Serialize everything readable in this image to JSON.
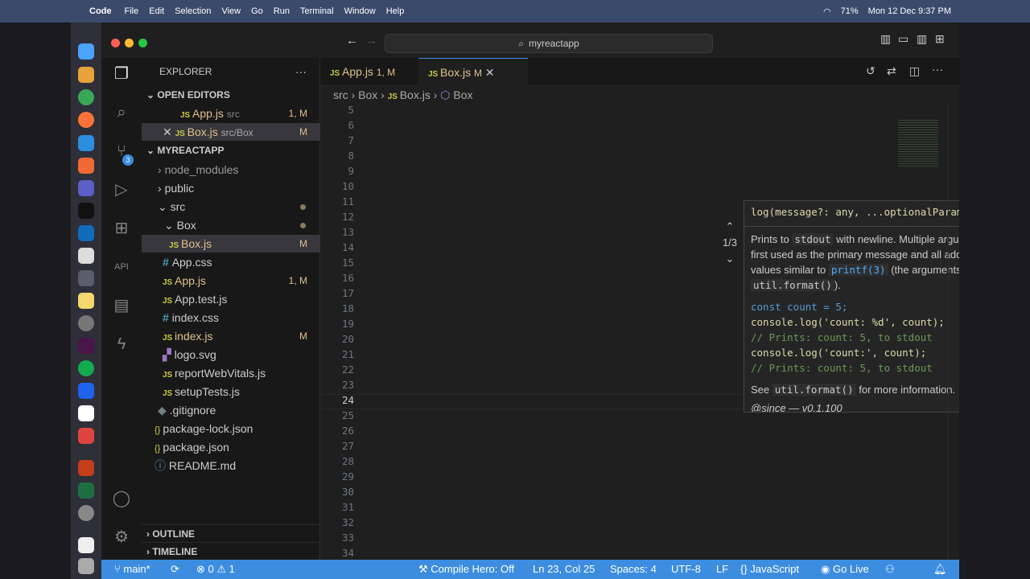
{
  "menubar": {
    "apple": "",
    "app": "Code",
    "items": [
      "File",
      "Edit",
      "Selection",
      "View",
      "Go",
      "Run",
      "Terminal",
      "Window",
      "Help"
    ],
    "battery": "71%",
    "datetime": "Mon 12 Dec 9:37 PM"
  },
  "window": {
    "search": "myreactapp",
    "scm_badge": "3"
  },
  "sidebar": {
    "title": "EXPLORER",
    "open_editors": "OPEN EDITORS",
    "oe1_name": "App.js",
    "oe1_path": "src",
    "oe1_badge": "1, M",
    "oe2_name": "Box.js",
    "oe2_path": "src/Box",
    "oe2_badge": "M",
    "project": "MYREACTAPP",
    "tree": [
      {
        "name": "node_modules"
      },
      {
        "name": "public"
      },
      {
        "name": "src"
      },
      {
        "name": "Box"
      },
      {
        "name": "Box.js",
        "badge": "M"
      },
      {
        "name": "App.css"
      },
      {
        "name": "App.js",
        "badge": "1, M"
      },
      {
        "name": "App.test.js"
      },
      {
        "name": "index.css"
      },
      {
        "name": "index.js",
        "badge": "M"
      },
      {
        "name": "logo.svg"
      },
      {
        "name": "reportWebVitals.js"
      },
      {
        "name": "setupTests.js"
      },
      {
        "name": ".gitignore"
      },
      {
        "name": "package-lock.json"
      },
      {
        "name": "package.json"
      },
      {
        "name": "README.md"
      }
    ],
    "outline": "OUTLINE",
    "timeline": "TIMELINE"
  },
  "tabs": {
    "t1": "App.js",
    "t1_badge": "1, M",
    "t2": "Box.js",
    "t2_badge": "M"
  },
  "breadcrumb": {
    "a": "src",
    "b": "Box",
    "c": "Box.js",
    "d": "Box"
  },
  "code_lines": [
    "5",
    "6",
    "7",
    "8",
    "9",
    "10",
    "11",
    "12",
    "13",
    "14",
    "15",
    "16",
    "17",
    "18",
    "19",
    "20",
    "21",
    "22",
    "23",
    "24",
    "25",
    "26",
    "27",
    "28",
    "29",
    "30",
    "31",
    "32",
    "33",
    "34"
  ],
  "hover": {
    "signature": "log(message?: any, ...optionalParams: any[]): void",
    "counter": "1/3",
    "p1a": "Prints to",
    "p1b": "stdout",
    "p1c": "with newline. Multiple arguments can be passed, with the first used as the primary message and all additional used as substitution values similar to",
    "p1d": "printf(3)",
    "p1e": "(the arguments are all passed to",
    "p1f": "util.format()",
    "p1g": ").",
    "ex1": "const count = 5;",
    "ex2": "console.log('count: %d', count);",
    "ex3": "// Prints: count: 5, to stdout",
    "ex4": "console.log('count:', count);",
    "ex5": "// Prints: count: 5, to stdout",
    "see1": "See",
    "see2": "util.format()",
    "see3": "for more information.",
    "since": "@since — v0.1.100"
  },
  "status": {
    "branch": "main*",
    "errors": "0",
    "warnings": "1",
    "compile": "Compile Hero: Off",
    "position": "Ln 23, Col 25",
    "spaces": "Spaces: 4",
    "encoding": "UTF-8",
    "eol": "LF",
    "lang": "JavaScript",
    "golive": "Go Live"
  },
  "colors": {
    "accent": "#3c8de0",
    "background": "#1f1f1f"
  }
}
